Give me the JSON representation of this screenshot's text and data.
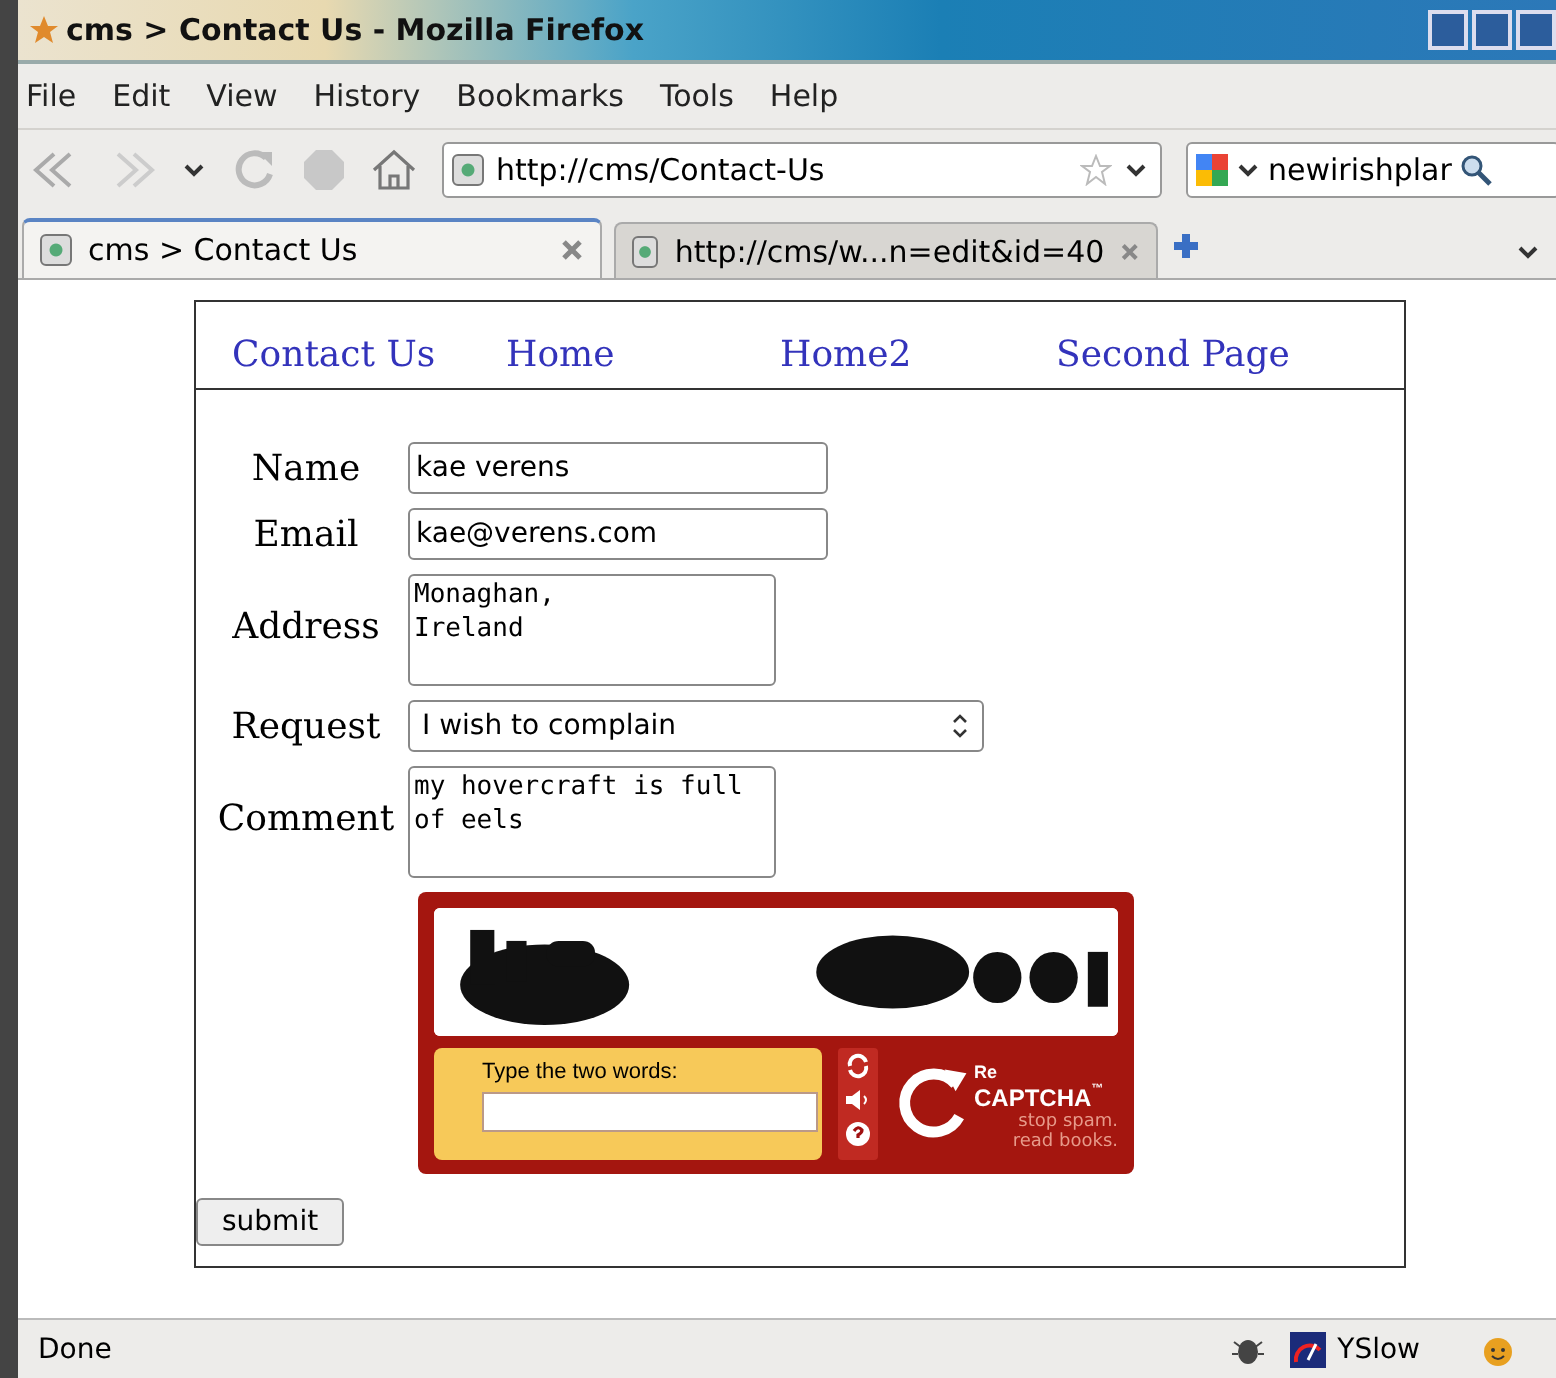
{
  "window": {
    "title": "cms > Contact Us - Mozilla Firefox"
  },
  "menu": [
    "File",
    "Edit",
    "View",
    "History",
    "Bookmarks",
    "Tools",
    "Help"
  ],
  "toolbar": {
    "url": "http://cms/Contact-Us",
    "search_value": "newirishplar"
  },
  "tabs": [
    {
      "label": "cms > Contact Us",
      "selected": true
    },
    {
      "label": "http://cms/w...n=edit&id=40",
      "selected": false
    }
  ],
  "page": {
    "nav": [
      "Contact Us",
      "Home",
      "Home2",
      "Second Page"
    ],
    "fields": [
      {
        "label": "Name",
        "kind": "input",
        "value": "kae verens"
      },
      {
        "label": "Email",
        "kind": "input",
        "value": "kae@verens.com"
      },
      {
        "label": "Address",
        "kind": "textarea",
        "value": "Monaghan,\nIreland"
      },
      {
        "label": "Request",
        "kind": "select",
        "value": "I wish to complain"
      },
      {
        "label": "Comment",
        "kind": "textarea",
        "value": "my hovercraft is full\nof eels"
      }
    ],
    "captcha": {
      "prompt": "Type the two words:",
      "logo_prefix": "Re",
      "logo": "CAPTCHA",
      "trademark": "™",
      "slogan_1": "stop spam.",
      "slogan_2": "read books."
    },
    "submit": "submit"
  },
  "status_bar": {
    "text": "Done",
    "yslow": "YSlow"
  }
}
